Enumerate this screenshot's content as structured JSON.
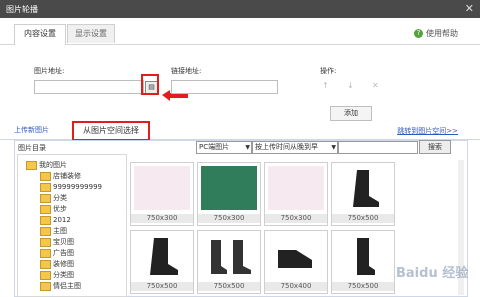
{
  "window": {
    "title": "图片轮播",
    "close": "✕"
  },
  "tabs": [
    {
      "label": "内容设置"
    },
    {
      "label": "显示设置"
    }
  ],
  "help": {
    "label": "使用帮助"
  },
  "form": {
    "image_url_label": "图片地址:",
    "link_url_label": "链接地址:",
    "ops_label": "操作:",
    "ops": {
      "up": "↑",
      "down": "↓",
      "delete": "✕"
    },
    "add_button": "添加"
  },
  "subtabs": {
    "upload": "上传新图片",
    "from_space": "从图片空间选择",
    "jump": "跳转到图片空间>>"
  },
  "picker": {
    "dir_label": "图片目录",
    "type_select": "PC端图片",
    "sort_select": "按上传时间从晚到早",
    "search_button": "搜索"
  },
  "tree": [
    {
      "label": "我的图片"
    },
    {
      "label": "店铺装修"
    },
    {
      "label": "99999999999"
    },
    {
      "label": "分类"
    },
    {
      "label": "优步"
    },
    {
      "label": "2012"
    },
    {
      "label": "主图"
    },
    {
      "label": "宝贝图"
    },
    {
      "label": "广告图"
    },
    {
      "label": "装修图"
    },
    {
      "label": "分类图"
    },
    {
      "label": "情侣主图"
    }
  ],
  "thumbnails": [
    {
      "caption": "750x300",
      "kind": "pink-banner"
    },
    {
      "caption": "750x300",
      "kind": "green-banner"
    },
    {
      "caption": "750x300",
      "kind": "pink-banner"
    },
    {
      "caption": "750x500",
      "kind": "boot"
    },
    {
      "caption": "750x500",
      "kind": "boot"
    },
    {
      "caption": "750x500",
      "kind": "boot-pair"
    },
    {
      "caption": "750x400",
      "kind": "boot"
    },
    {
      "caption": "750x500",
      "kind": "boot"
    }
  ],
  "watermark": "Baidu 经验",
  "colors": {
    "accent_red": "#e21d1d",
    "link_blue": "#2a5bb7",
    "titlebar": "#4a4a4a"
  }
}
